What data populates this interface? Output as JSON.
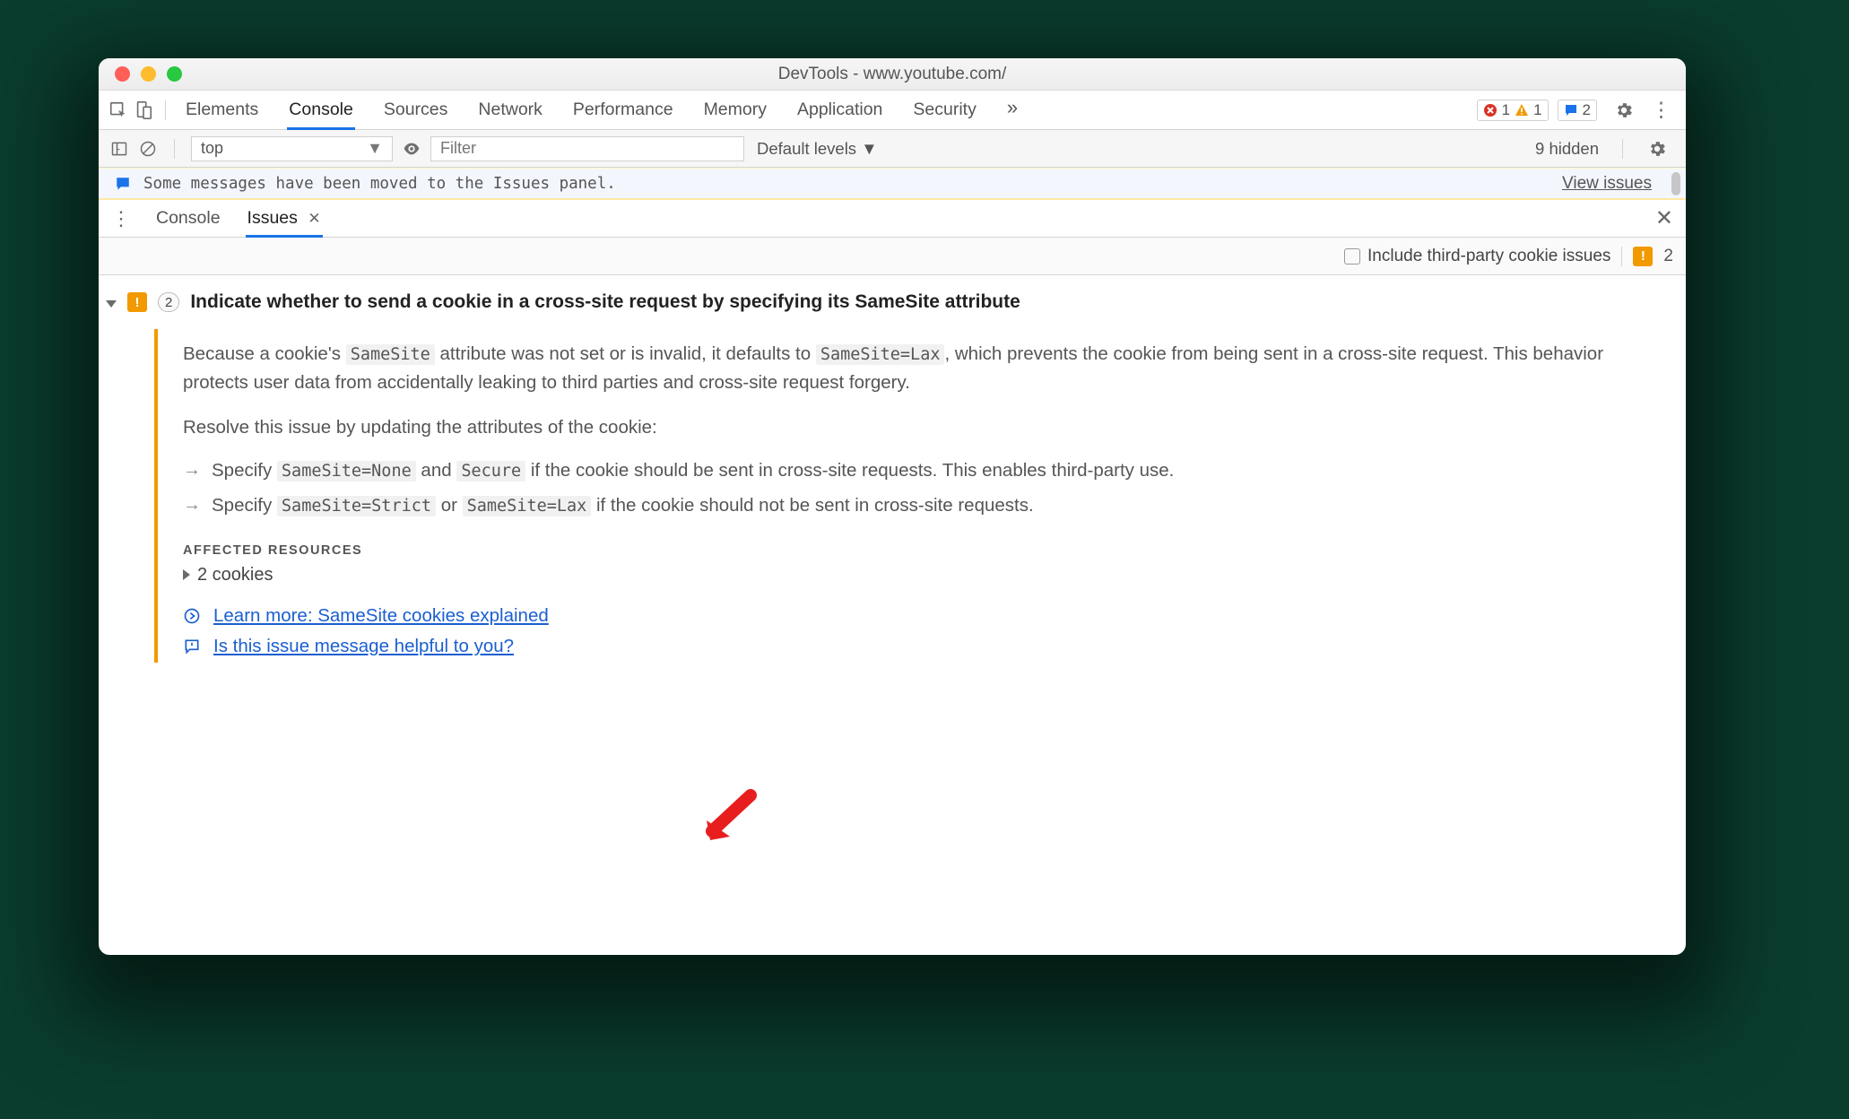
{
  "titlebar": {
    "title": "DevTools - www.youtube.com/"
  },
  "tabstrip": {
    "tabs": [
      "Elements",
      "Console",
      "Sources",
      "Network",
      "Performance",
      "Memory",
      "Application",
      "Security"
    ],
    "active": "Console",
    "overflow": "»",
    "error_count": "1",
    "warn_count": "1",
    "msg_count": "2"
  },
  "filterbar": {
    "context": "top",
    "filter_placeholder": "Filter",
    "levels": "Default levels ▼",
    "hidden": "9 hidden"
  },
  "banner": {
    "message": "Some messages have been moved to the Issues panel.",
    "link": "View issues"
  },
  "drawer": {
    "tabs": [
      "Console",
      "Issues"
    ],
    "active": "Issues",
    "include_third_party": "Include third-party cookie issues",
    "warn_total": "2"
  },
  "issue": {
    "count": "2",
    "title": "Indicate whether to send a cookie in a cross-site request by specifying its SameSite attribute",
    "desc_a": "Because a cookie's ",
    "code_samesite": "SameSite",
    "desc_b": " attribute was not set or is invalid, it defaults to ",
    "code_lax": "SameSite=Lax",
    "desc_c": ", which prevents the cookie from being sent in a cross-site request. This behavior protects user data from accidentally leaking to third parties and cross-site request forgery.",
    "resolve": "Resolve this issue by updating the attributes of the cookie:",
    "bullet1_a": "Specify ",
    "bullet1_code1": "SameSite=None",
    "bullet1_b": " and ",
    "bullet1_code2": "Secure",
    "bullet1_c": " if the cookie should be sent in cross-site requests. This enables third-party use.",
    "bullet2_a": "Specify ",
    "bullet2_code1": "SameSite=Strict",
    "bullet2_b": " or ",
    "bullet2_code2": "SameSite=Lax",
    "bullet2_c": " if the cookie should not be sent in cross-site requests.",
    "affected_heading": "AFFECTED RESOURCES",
    "affected_row": "2 cookies",
    "link_learn": "Learn more: SameSite cookies explained",
    "link_feedback": "Is this issue message helpful to you?"
  }
}
